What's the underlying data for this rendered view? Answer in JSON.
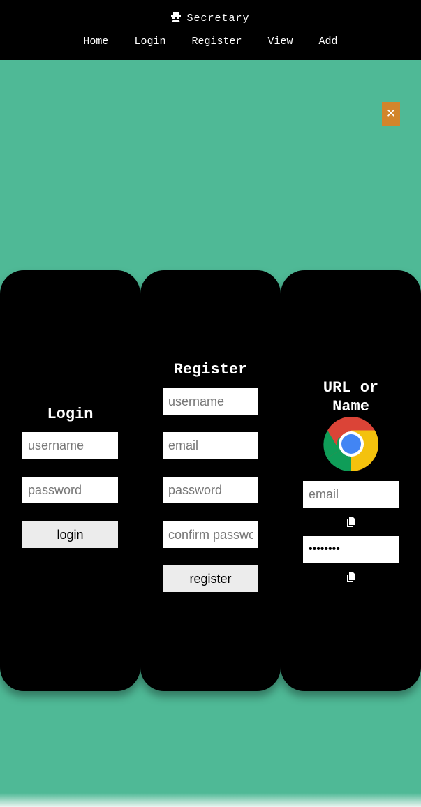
{
  "header": {
    "title": "Secretary",
    "icon": "spy-icon",
    "nav": [
      "Home",
      "Login",
      "Register",
      "View",
      "Add"
    ]
  },
  "close_button": {
    "label": "✕",
    "color": "#d2852b"
  },
  "login": {
    "heading": "Login",
    "username_placeholder": "username",
    "password_placeholder": "password",
    "button": "login"
  },
  "register": {
    "heading": "Register",
    "username_placeholder": "username",
    "email_placeholder": "email",
    "password_placeholder": "password",
    "confirm_placeholder": "confirm password",
    "button": "register"
  },
  "entry": {
    "heading": "URL or Name",
    "site_icon": "chrome-icon",
    "email_placeholder": "email",
    "password_value": "••••••••",
    "copy_icon": "copy-icon"
  },
  "colors": {
    "background": "#4fb996",
    "card": "#000000",
    "accent": "#d2852b"
  }
}
